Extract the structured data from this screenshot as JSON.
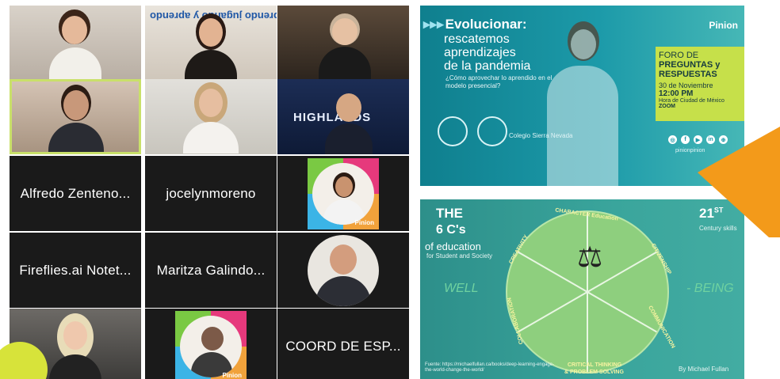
{
  "gallery": {
    "banner_text": "Aprendo jugando y aprendo",
    "highlands_text": "HIGHLANDS",
    "names": {
      "alfredo": "Alfredo Zenteno...",
      "jocelyn": "jocelynmoreno",
      "fireflies": "Fireflies.ai Notet...",
      "maritza": "Maritza Galindo...",
      "coord": "COORD DE ESP..."
    },
    "pinion_tag": "Pinion",
    "colors": {
      "tile_bg": "#1a1a1a",
      "active_border": "#c9e06a"
    }
  },
  "slide1": {
    "title": "Evolucionar:",
    "arrows": "▸▸▸",
    "subtitle_lines": [
      "rescatemos",
      "aprendizajes",
      "de la pandemia"
    ],
    "question": "¿Cómo aprovechar lo aprendido en el modelo presencial?",
    "brand": "Pinion",
    "foro": {
      "line1": "FORO DE",
      "line2": "PREGUNTAS y RESPUESTAS",
      "date": "30 de Noviembre",
      "time": "12:00 PM",
      "tz": "Hora de Ciudad de México",
      "platform": "ZOOM"
    },
    "handle": "pinionpinion",
    "sierra": "Colegio Sierra Nevada"
  },
  "slide2": {
    "the": "THE",
    "six_cs": "6 C's",
    "of_education": "of education",
    "for_line": "for Student and Society",
    "well": "WELL",
    "being": "- BEING",
    "twenty_first": "21",
    "st": "ST",
    "century": "Century skills",
    "labels": {
      "character": "CHARACTER Education",
      "citizenship": "CITIZENSHIP",
      "communication": "COMMUNICATION",
      "critical": "CRITICAL THINKING",
      "problem": "& PROBLEM SOLVING",
      "collaboration": "COLLABORATION",
      "creativity": "CREATIVITY"
    },
    "source": "Fuente: https://michaelfullan.ca/books/deep-learning-engage-the-world-change-the-world/",
    "by": "By Michael Fullan"
  }
}
